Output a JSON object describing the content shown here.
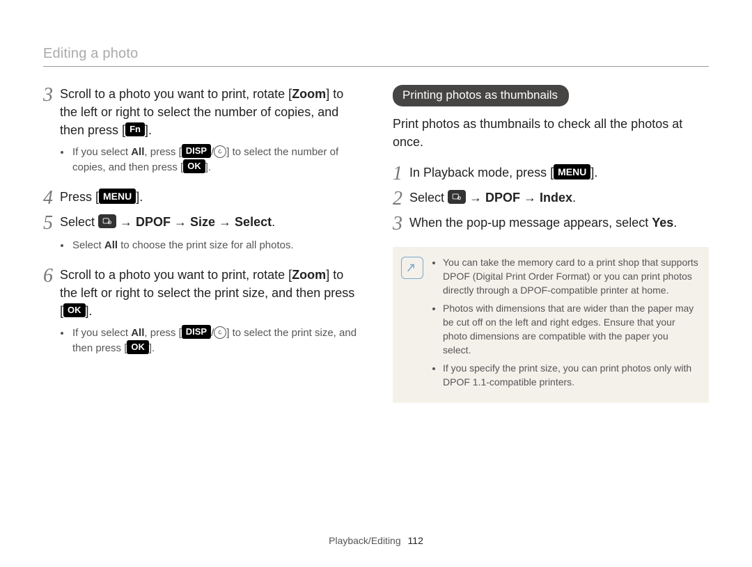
{
  "page": {
    "title": "Editing a photo",
    "footer_section": "Playback/Editing",
    "footer_page": "112"
  },
  "icons": {
    "fn": "Fn",
    "disp": "DISP",
    "ok": "OK",
    "menu": "MENU"
  },
  "left": {
    "step3": {
      "num": "3",
      "pre": "Scroll to a photo you want to print, rotate [",
      "zoom": "Zoom",
      "mid": "] to the left or right to select the number of copies, and then press [",
      "end": "]."
    },
    "step3_sub": {
      "pre": "If you select ",
      "all": "All",
      "mid1": ", press [",
      "slash": "/",
      "mid2": "] to select the number of copies, and then press [",
      "end": "]."
    },
    "step4": {
      "num": "4",
      "pre": "Press [",
      "end": "]."
    },
    "step5": {
      "num": "5",
      "pre": "Select ",
      "path": " → DPOF → Size → Select",
      "end": "."
    },
    "step5_sub": {
      "pre": "Select ",
      "all": "All",
      "post": " to choose the print size for all photos."
    },
    "step6": {
      "num": "6",
      "pre": "Scroll to a photo you want to print, rotate [",
      "zoom": "Zoom",
      "mid": "] to the left or right to select the print size, and then press [",
      "end": "]."
    },
    "step6_sub": {
      "pre": "If you select ",
      "all": "All",
      "mid1": ", press [",
      "slash": "/",
      "mid2": "] to select the print size, and then press [",
      "end": "]."
    }
  },
  "right": {
    "section_title": "Printing photos as thumbnails",
    "intro": "Print photos as thumbnails to check all the photos at once.",
    "step1": {
      "num": "1",
      "pre": "In Playback mode, press [",
      "end": "]."
    },
    "step2": {
      "num": "2",
      "pre": "Select ",
      "path": " → DPOF → Index",
      "end": "."
    },
    "step3": {
      "num": "3",
      "pre": "When the pop-up message appears, select ",
      "yes": "Yes",
      "end": "."
    },
    "notes": [
      "You can take the memory card to a print shop that supports DPOF (Digital Print Order Format) or you can print photos directly through a DPOF-compatible printer at home.",
      "Photos with dimensions that are wider than the paper may be cut off on the left and right edges. Ensure that your photo dimensions are compatible with the paper you select.",
      "If you specify the print size, you can print photos only with DPOF 1.1-compatible printers."
    ]
  }
}
